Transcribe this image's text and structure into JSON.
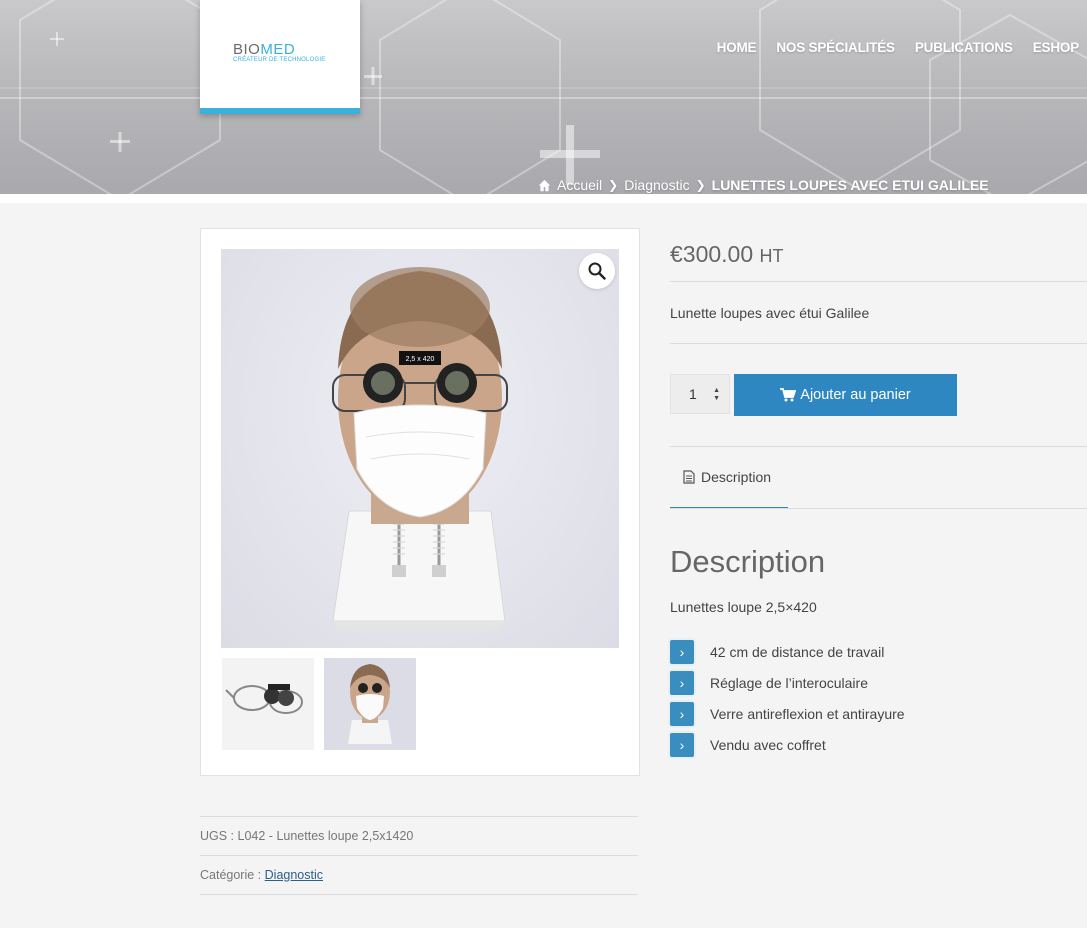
{
  "brand": {
    "name_part1": "BIO",
    "name_part2": "MED",
    "tagline": "CRÉATEUR DE TECHNOLOGIE"
  },
  "nav": {
    "items": [
      "HOME",
      "NOS SPÉCIALITÉS",
      "PUBLICATIONS",
      "ESHOP"
    ]
  },
  "breadcrumb": {
    "home": "Accueil",
    "category": "Diagnostic",
    "current": "LUNETTES LOUPES AVEC ETUI GALILEE"
  },
  "product": {
    "price": "€300.00",
    "price_suffix": "HT",
    "short_description": "Lunette loupes avec étui Galilee",
    "quantity": "1",
    "add_to_cart": "Ajouter au panier",
    "tab_label": "Description",
    "description_heading": "Description",
    "description_sub": "Lunettes loupe 2,5×420",
    "features": [
      "42 cm de distance de travail",
      "Réglage de l’interoculaire",
      "Verre antireflexion et antirayure",
      "Vendu avec coffret"
    ],
    "loupe_marking": "2,5 x 420",
    "sku_label": "UGS :",
    "sku_value": "L042 - Lunettes loupe 2,5x1420",
    "category_label": "Catégorie :",
    "category_value": "Diagnostic"
  },
  "colors": {
    "accent": "#2e87c0",
    "logo_blue": "#3ab0dc"
  },
  "icons": {
    "zoom": "magnifier-icon",
    "home": "home-icon",
    "cart": "cart-icon",
    "tab": "document-icon",
    "bullet": "chevron-right-icon"
  }
}
